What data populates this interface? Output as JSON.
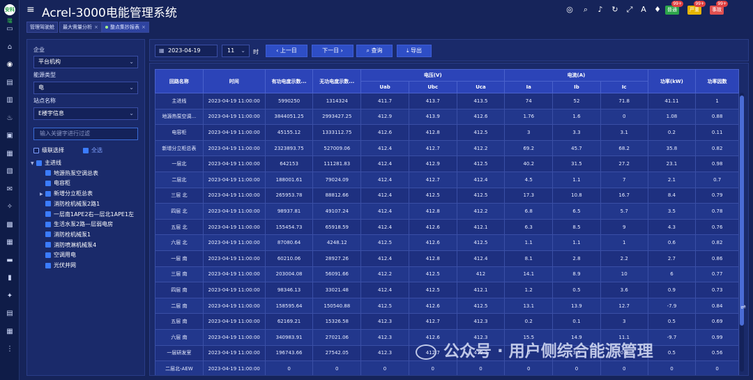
{
  "app": {
    "title": "Acrel-3000电能管理系统",
    "logo_text": "安科瑞"
  },
  "sidebar_icons": [
    "monitor-icon",
    "home-icon",
    "dashboard-icon",
    "document-icon",
    "chart-icon",
    "alarm-icon",
    "report-icon",
    "grid-icon",
    "device-icon",
    "message-icon",
    "bulb-icon",
    "doc-icon",
    "table-icon",
    "monitor2-icon",
    "bottle-icon",
    "key-icon",
    "list-icon",
    "equipment-icon",
    "more-icon"
  ],
  "header": {
    "badges": [
      {
        "label": "普通",
        "count": "99+",
        "color": "#2ca54a"
      },
      {
        "label": "严重",
        "count": "99+",
        "color": "#e6b400"
      },
      {
        "label": "事故",
        "count": "99+",
        "color": "#e05050"
      }
    ]
  },
  "tabs": [
    {
      "label": "管理驾驶舱",
      "closable": false
    },
    {
      "label": "最大需量分析",
      "closable": true
    },
    {
      "label": "整点集抄报表",
      "closable": true
    }
  ],
  "filters": {
    "enterprise_label": "企业",
    "enterprise_value": "平台机构",
    "energy_label": "能源类型",
    "energy_value": "电",
    "station_label": "站点名称",
    "station_value": "E楼宇信息",
    "keyword_placeholder": "输入关键字进行过滤",
    "cascade_label": "级联选择",
    "select_all_label": "全选"
  },
  "tree": [
    {
      "label": "主进线",
      "level": 0,
      "expanded": true
    },
    {
      "label": "地源热泵空调总表",
      "level": 1
    },
    {
      "label": "电容柜",
      "level": 1
    },
    {
      "label": "新增分立柜总表",
      "level": 1,
      "has_children": true
    },
    {
      "label": "消防栓机械泵2路1",
      "level": 1
    },
    {
      "label": "一层南1APE2右—层北1APE1左",
      "level": 1
    },
    {
      "label": "生活水泵2路—层弱电房",
      "level": 1
    },
    {
      "label": "消防栓机械泵1",
      "level": 1
    },
    {
      "label": "消防喷淋机械泵4",
      "level": 1
    },
    {
      "label": "空调用电",
      "level": 1
    },
    {
      "label": "光伏并网",
      "level": 1
    }
  ],
  "toolbar": {
    "date": "2023-04-19",
    "hour": "11",
    "hour_unit": "时",
    "prev_label": "上一日",
    "next_label": "下一日",
    "query_label": "查询",
    "export_label": "导出"
  },
  "table": {
    "headers": {
      "name": "回路名称",
      "time": "时间",
      "active": "有功电度示数...",
      "reactive": "无功电度示数...",
      "voltage_group": "电压(V)",
      "current_group": "电流(A)",
      "uab": "Uab",
      "ubc": "Ubc",
      "uca": "Uca",
      "ia": "Ia",
      "ib": "Ib",
      "ic": "Ic",
      "power": "功率(kW)",
      "pf": "功率因数"
    },
    "rows": [
      [
        "主进线",
        "2023-04-19 11:00:00",
        "5990250",
        "1314324",
        "411.7",
        "413.7",
        "413.5",
        "74",
        "52",
        "71.8",
        "41.11",
        "1"
      ],
      [
        "地源热泵空调...",
        "2023-04-19 11:00:00",
        "3844051.25",
        "2993427.25",
        "412.9",
        "413.9",
        "412.6",
        "1.76",
        "1.6",
        "0",
        "1.08",
        "0.88"
      ],
      [
        "电容柜",
        "2023-04-19 11:00:00",
        "45155.12",
        "1333112.75",
        "412.6",
        "412.8",
        "412.5",
        "3",
        "3.3",
        "3.1",
        "0.2",
        "0.11"
      ],
      [
        "新增分立柜总表",
        "2023-04-19 11:00:00",
        "2323893.75",
        "527009.06",
        "412.4",
        "412.7",
        "412.2",
        "69.2",
        "45.7",
        "68.2",
        "35.8",
        "0.82"
      ],
      [
        "一层北",
        "2023-04-19 11:00:00",
        "642153",
        "111281.83",
        "412.4",
        "412.9",
        "412.5",
        "40.2",
        "31.5",
        "27.2",
        "23.1",
        "0.98"
      ],
      [
        "二层北",
        "2023-04-19 11:00:00",
        "188001.61",
        "79024.09",
        "412.4",
        "412.7",
        "412.4",
        "4.5",
        "1.1",
        "7",
        "2.1",
        "0.7"
      ],
      [
        "三层 北",
        "2023-04-19 11:00:00",
        "265953.78",
        "88812.66",
        "412.4",
        "412.5",
        "412.5",
        "17.3",
        "10.8",
        "16.7",
        "8.4",
        "0.79"
      ],
      [
        "四层 北",
        "2023-04-19 11:00:00",
        "98937.81",
        "49107.24",
        "412.4",
        "412.8",
        "412.2",
        "6.8",
        "6.5",
        "5.7",
        "3.5",
        "0.78"
      ],
      [
        "五层 北",
        "2023-04-19 11:00:00",
        "155454.73",
        "65918.59",
        "412.4",
        "412.6",
        "412.1",
        "6.3",
        "8.5",
        "9",
        "4.3",
        "0.76"
      ],
      [
        "六层 北",
        "2023-04-19 11:00:00",
        "87080.64",
        "4248.12",
        "412.5",
        "412.6",
        "412.5",
        "1.1",
        "1.1",
        "1",
        "0.6",
        "0.82"
      ],
      [
        "一层 南",
        "2023-04-19 11:00:00",
        "60210.06",
        "28927.26",
        "412.4",
        "412.8",
        "412.4",
        "8.1",
        "2.8",
        "2.2",
        "2.7",
        "0.86"
      ],
      [
        "三层 南",
        "2023-04-19 11:00:00",
        "203004.08",
        "56091.66",
        "412.2",
        "412.5",
        "412",
        "14.1",
        "8.9",
        "10",
        "6",
        "0.77"
      ],
      [
        "四层 南",
        "2023-04-19 11:00:00",
        "98346.13",
        "33021.48",
        "412.4",
        "412.5",
        "412.1",
        "1.2",
        "0.5",
        "3.6",
        "0.9",
        "0.73"
      ],
      [
        "二层 南",
        "2023-04-19 11:00:00",
        "158595.64",
        "150540.88",
        "412.5",
        "412.6",
        "412.5",
        "13.1",
        "13.9",
        "12.7",
        "-7.9",
        "0.84"
      ],
      [
        "五层 南",
        "2023-04-19 11:00:00",
        "62169.21",
        "15326.58",
        "412.3",
        "412.7",
        "412.3",
        "0.2",
        "0.1",
        "3",
        "0.5",
        "0.69"
      ],
      [
        "六层 南",
        "2023-04-19 11:00:00",
        "340983.91",
        "27021.06",
        "412.3",
        "412.6",
        "412.3",
        "15.5",
        "14.9",
        "11.1",
        "-9.7",
        "0.99"
      ],
      [
        "一层研发室",
        "2023-04-19 11:00:00",
        "196743.66",
        "27542.05",
        "412.3",
        "412.7",
        "412.3",
        "0",
        "3.5",
        "0.4",
        "0.5",
        "0.56"
      ],
      [
        "二层北-AEW",
        "2023-04-19 11:00:00",
        "0",
        "0",
        "0",
        "0",
        "0",
        "0",
        "0",
        "0",
        "0",
        "0"
      ]
    ]
  },
  "watermark": "公众号 · 用户侧综合能源管理"
}
